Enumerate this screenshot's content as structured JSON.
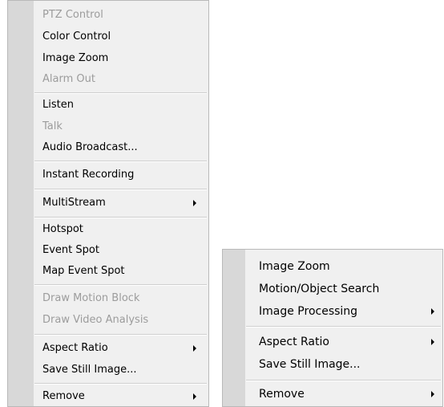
{
  "menu_left": {
    "items": [
      {
        "label": "PTZ Control",
        "enabled": false
      },
      {
        "label": "Color Control",
        "enabled": true
      },
      {
        "label": "Image Zoom",
        "enabled": true
      },
      {
        "label": "Alarm Out",
        "enabled": false
      },
      {
        "label": "Listen",
        "enabled": true
      },
      {
        "label": "Talk",
        "enabled": false
      },
      {
        "label": "Audio Broadcast...",
        "enabled": true
      },
      {
        "label": "Instant Recording",
        "enabled": true
      },
      {
        "label": "MultiStream",
        "enabled": true,
        "submenu": true
      },
      {
        "label": "Hotspot",
        "enabled": true
      },
      {
        "label": "Event Spot",
        "enabled": true
      },
      {
        "label": "Map Event Spot",
        "enabled": true
      },
      {
        "label": "Draw Motion Block",
        "enabled": false
      },
      {
        "label": "Draw Video Analysis",
        "enabled": false
      },
      {
        "label": "Aspect Ratio",
        "enabled": true,
        "submenu": true
      },
      {
        "label": "Save Still Image...",
        "enabled": true
      },
      {
        "label": "Remove",
        "enabled": true,
        "submenu": true
      }
    ]
  },
  "menu_right": {
    "items": [
      {
        "label": "Image Zoom",
        "enabled": true
      },
      {
        "label": "Motion/Object Search",
        "enabled": true
      },
      {
        "label": "Image Processing",
        "enabled": true,
        "submenu": true
      },
      {
        "label": "Aspect Ratio",
        "enabled": true,
        "submenu": true
      },
      {
        "label": "Save Still Image...",
        "enabled": true
      },
      {
        "label": "Remove",
        "enabled": true,
        "submenu": true
      }
    ]
  },
  "colors": {
    "menu_background": "#f0f0f0",
    "icon_gutter": "#d8d8d8",
    "disabled_text": "#9c9c9c",
    "border": "#b9b9b9"
  }
}
